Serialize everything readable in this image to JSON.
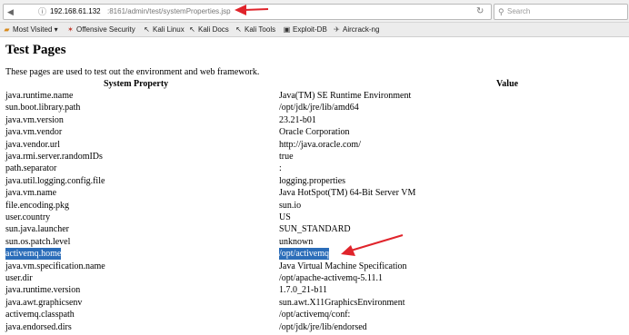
{
  "browser": {
    "url_host": "192.168.61.132",
    "url_rest": ":8161/admin/test/systemProperties.jsp",
    "search_placeholder": "Search",
    "icons": [
      "arrow-left-icon",
      "info-icon",
      "reload-icon",
      "search-icon"
    ]
  },
  "bookmarks": [
    {
      "label": "Most Visited ▾",
      "icon": "folder-icon"
    },
    {
      "label": "Offensive Security",
      "icon": "kali-dragon-icon"
    },
    {
      "label": "Kali Linux",
      "icon": "kali-dragon-icon"
    },
    {
      "label": "Kali Docs",
      "icon": "kali-dragon-icon"
    },
    {
      "label": "Kali Tools",
      "icon": "kali-dragon-icon"
    },
    {
      "label": "Exploit-DB",
      "icon": "exploit-db-icon"
    },
    {
      "label": "Aircrack-ng",
      "icon": "aircrack-icon"
    }
  ],
  "page": {
    "title": "Test Pages",
    "intro": "These pages are used to test out the environment and web framework.",
    "header_property": "System Property",
    "header_value": "Value",
    "highlight_color": "#2b6db9",
    "annotation_color": "#e0242b"
  },
  "properties": [
    {
      "key": "java.runtime.name",
      "value": "Java(TM) SE Runtime Environment"
    },
    {
      "key": "sun.boot.library.path",
      "value": "/opt/jdk/jre/lib/amd64"
    },
    {
      "key": "java.vm.version",
      "value": "23.21-b01"
    },
    {
      "key": "java.vm.vendor",
      "value": "Oracle Corporation"
    },
    {
      "key": "java.vendor.url",
      "value": "http://java.oracle.com/"
    },
    {
      "key": "java.rmi.server.randomIDs",
      "value": "true"
    },
    {
      "key": "path.separator",
      "value": ":"
    },
    {
      "key": "java.util.logging.config.file",
      "value": "logging.properties"
    },
    {
      "key": "java.vm.name",
      "value": "Java HotSpot(TM) 64-Bit Server VM"
    },
    {
      "key": "file.encoding.pkg",
      "value": "sun.io"
    },
    {
      "key": "user.country",
      "value": "US"
    },
    {
      "key": "sun.java.launcher",
      "value": "SUN_STANDARD"
    },
    {
      "key": "sun.os.patch.level",
      "value": "unknown"
    },
    {
      "key": "activemq.home",
      "value": "/opt/activemq",
      "selected": true
    },
    {
      "key": "java.vm.specification.name",
      "value": "Java Virtual Machine Specification"
    },
    {
      "key": "user.dir",
      "value": "/opt/apache-activemq-5.11.1"
    },
    {
      "key": "java.runtime.version",
      "value": "1.7.0_21-b11"
    },
    {
      "key": "java.awt.graphicsenv",
      "value": "sun.awt.X11GraphicsEnvironment"
    },
    {
      "key": "activemq.classpath",
      "value": "/opt/activemq/conf:"
    },
    {
      "key": "java.endorsed.dirs",
      "value": "/opt/jdk/jre/lib/endorsed"
    }
  ]
}
